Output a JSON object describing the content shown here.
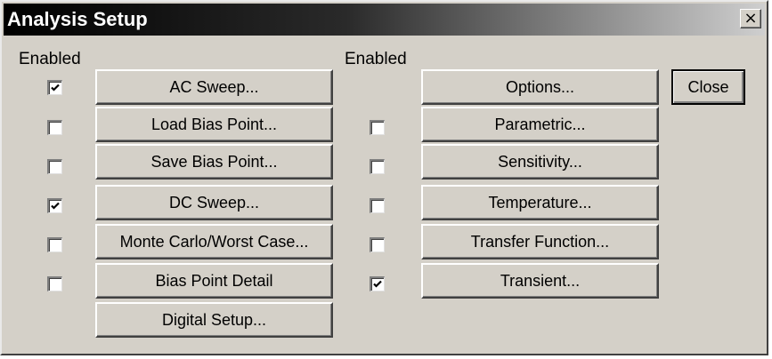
{
  "window": {
    "title": "Analysis Setup",
    "close_glyph": "×"
  },
  "left_column": {
    "header": "Enabled",
    "rows": [
      {
        "label": "AC Sweep...",
        "checked": true
      },
      {
        "label": "Load Bias Point...",
        "checked": false
      },
      {
        "label": "Save Bias Point...",
        "checked": false
      },
      {
        "label": "DC Sweep...",
        "checked": true
      },
      {
        "label": "Monte Carlo/Worst Case...",
        "checked": false
      },
      {
        "label": "Bias Point Detail",
        "checked": false
      }
    ],
    "digital_setup_label": "Digital Setup..."
  },
  "right_column": {
    "header": "Enabled",
    "options_label": "Options...",
    "rows": [
      {
        "label": "Parametric...",
        "checked": false
      },
      {
        "label": "Sensitivity...",
        "checked": false
      },
      {
        "label": "Temperature...",
        "checked": false
      },
      {
        "label": "Transfer Function...",
        "checked": false
      },
      {
        "label": "Transient...",
        "checked": true
      }
    ]
  },
  "close_button": {
    "label": "Close"
  },
  "colors": {
    "face": "#d4d0c8",
    "title_start": "#000000",
    "title_end": "#cfcfcf",
    "title_text": "#ffffff"
  }
}
